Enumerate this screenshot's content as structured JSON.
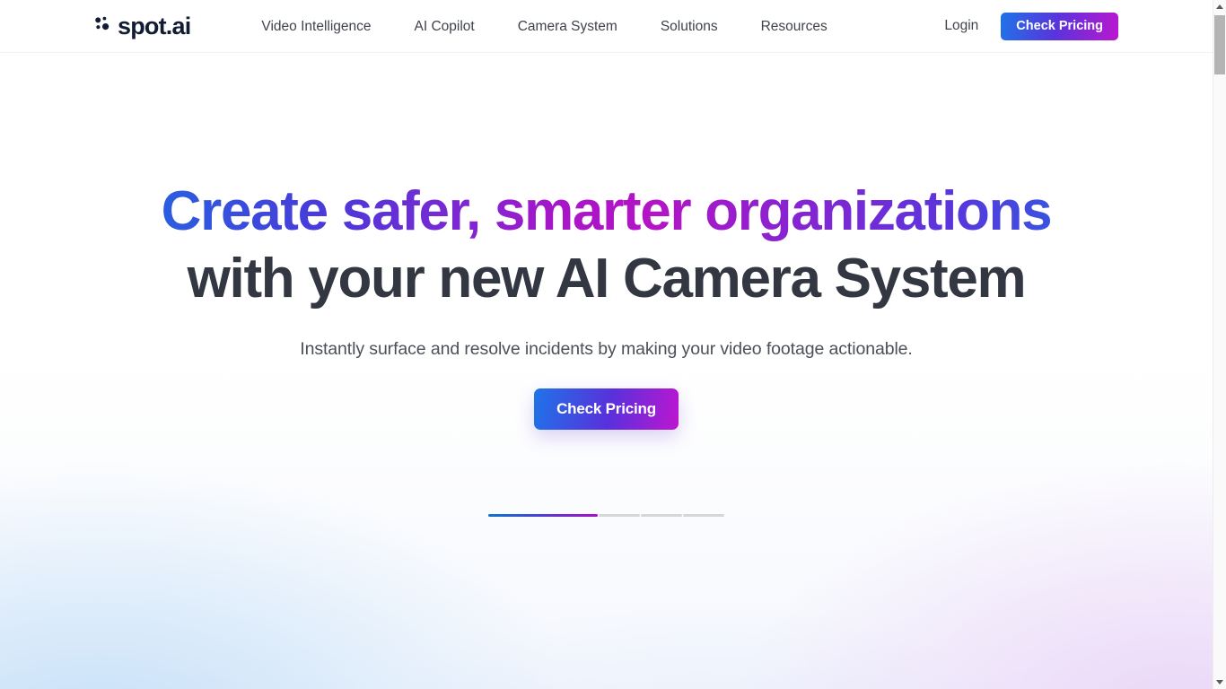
{
  "header": {
    "logo": {
      "name": "spot.ai",
      "wordmark": "spot.ai",
      "icon": "spot-ai-dots-logo"
    },
    "nav_items": [
      {
        "label": "Video Intelligence"
      },
      {
        "label": "AI Copilot"
      },
      {
        "label": "Camera System"
      },
      {
        "label": "Solutions"
      },
      {
        "label": "Resources"
      }
    ],
    "login_label": "Login",
    "cta_label": "Check Pricing"
  },
  "hero": {
    "headline_line1": "Create safer, smarter organizations",
    "headline_line2": "with your new AI Camera System",
    "subheadline": "Instantly surface and resolve incidents by making your video footage actionable.",
    "cta_label": "Check Pricing",
    "carousel": {
      "total": 4,
      "active_index": 0,
      "slides": [
        {
          "state": "active"
        },
        {
          "state": "idle"
        },
        {
          "state": "idle"
        },
        {
          "state": "idle"
        }
      ]
    }
  },
  "colors": {
    "brand_blue": "#1668e3",
    "brand_purple": "#5831dc",
    "brand_magenta": "#bd16d0",
    "headline_dark": "#323741",
    "body_text": "#4c5059",
    "nav_text": "#3f434c",
    "logo_navy": "#121c33",
    "progress_idle": "#d6d7da",
    "page_background": "#ffffff"
  },
  "scrollbar": {
    "up_icon": "chevron-up-icon",
    "down_icon": "chevron-down-icon"
  }
}
